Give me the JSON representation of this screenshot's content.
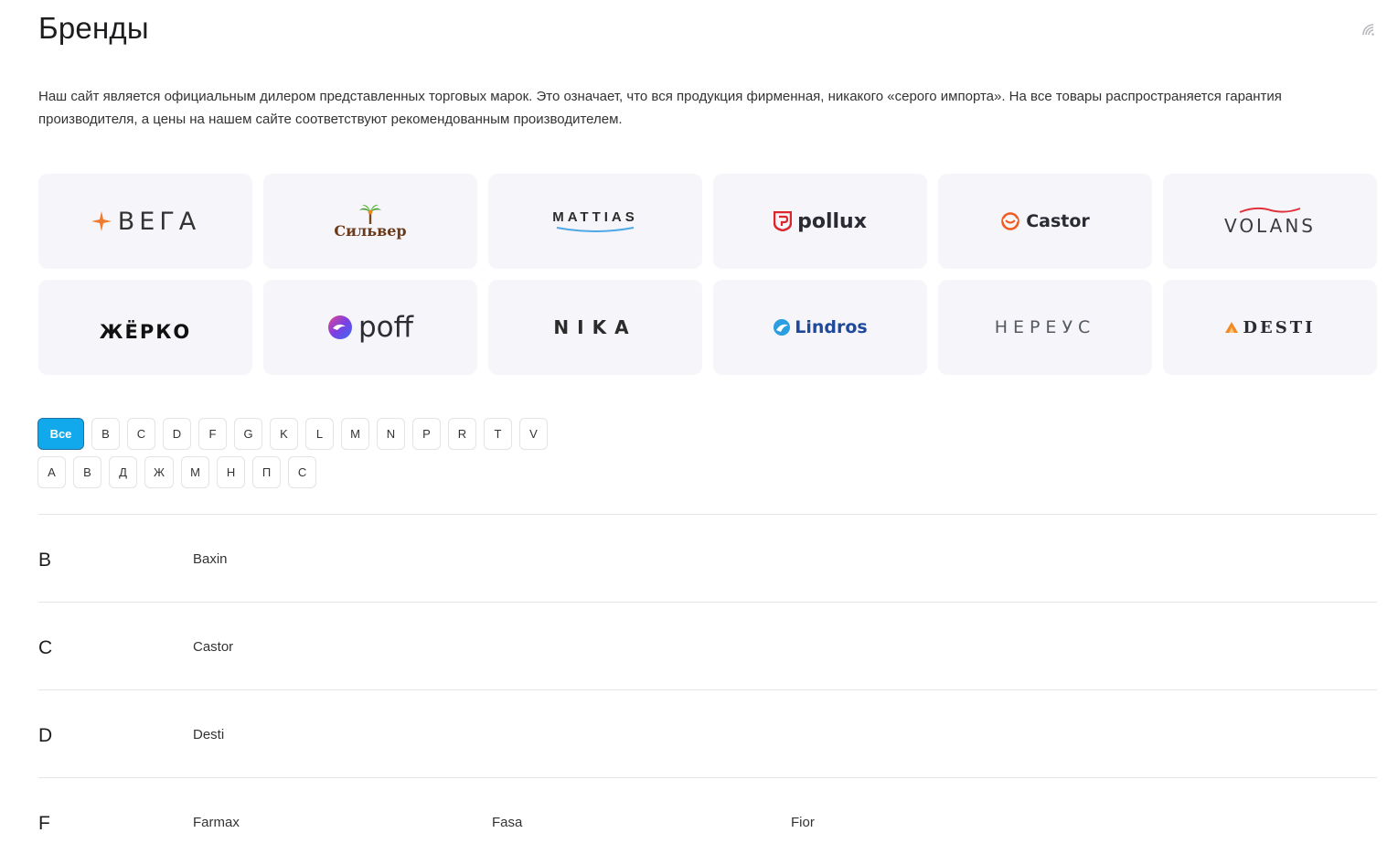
{
  "page": {
    "title": "Бренды",
    "intro": "Наш сайт является официальным дилером представленных торговых марок. Это означает, что вся продукция фирменная, никакого «серого импорта». На все товары распространяется гарантия производителя, а цены на нашем сайте соответствуют рекомендованным производителем."
  },
  "logos": [
    {
      "text": "ВЕГА",
      "icon": "star-icon",
      "color": "#333333",
      "accent": "#f07b2c"
    },
    {
      "text": "Сильвер",
      "icon": "palm-icon",
      "color": "#6b3a1a",
      "accent": "#e58b1c"
    },
    {
      "text": "MATTIAS",
      "icon": "swoosh-icon",
      "color": "#2b2b2b",
      "accent": "#4fa7e6"
    },
    {
      "text": "pollux",
      "icon": "shield-icon",
      "color": "#2b2b33",
      "accent": "#d9262f"
    },
    {
      "text": "Castor",
      "icon": "castor-icon",
      "color": "#2b2b33",
      "accent": "#f05a23"
    },
    {
      "text": "VOLANS",
      "icon": "wave-icon",
      "color": "#3b3b40",
      "accent": "#e0323c"
    },
    {
      "text": "ЖЁРКО",
      "icon": "accent-icon",
      "color": "#111111",
      "accent": "#e0762a"
    },
    {
      "text": "poff",
      "icon": "swirl-icon",
      "color": "#2d2d35",
      "accent": "#7b3fe4"
    },
    {
      "text": "NIKA",
      "icon": "none",
      "color": "#2b2b2b",
      "accent": "#2b2b2b"
    },
    {
      "text": "Lindros",
      "icon": "drop-icon",
      "color": "#1f4a9c",
      "accent": "#2a9ee0"
    },
    {
      "text": "НЕРЕУС",
      "icon": "none",
      "color": "#555a60",
      "accent": "#7fcf7f"
    },
    {
      "text": "DESTI",
      "icon": "triangle-icon",
      "color": "#2b2b33",
      "accent": "#f08a24"
    }
  ],
  "filters": {
    "latin": [
      "Все",
      "B",
      "C",
      "D",
      "F",
      "G",
      "K",
      "L",
      "M",
      "N",
      "P",
      "R",
      "T",
      "V"
    ],
    "cyrillic": [
      "А",
      "В",
      "Д",
      "Ж",
      "М",
      "Н",
      "П",
      "С"
    ]
  },
  "sections": [
    {
      "letter": "B",
      "brands": [
        "Baxin"
      ]
    },
    {
      "letter": "C",
      "brands": [
        "Castor"
      ]
    },
    {
      "letter": "D",
      "brands": [
        "Desti"
      ]
    },
    {
      "letter": "F",
      "brands": [
        "Farmax",
        "Fasa",
        "Fior"
      ]
    }
  ],
  "colors": {
    "accent": "#12a9ec",
    "tile_bg": "#f6f6fa",
    "divider": "#e6e6ea"
  }
}
